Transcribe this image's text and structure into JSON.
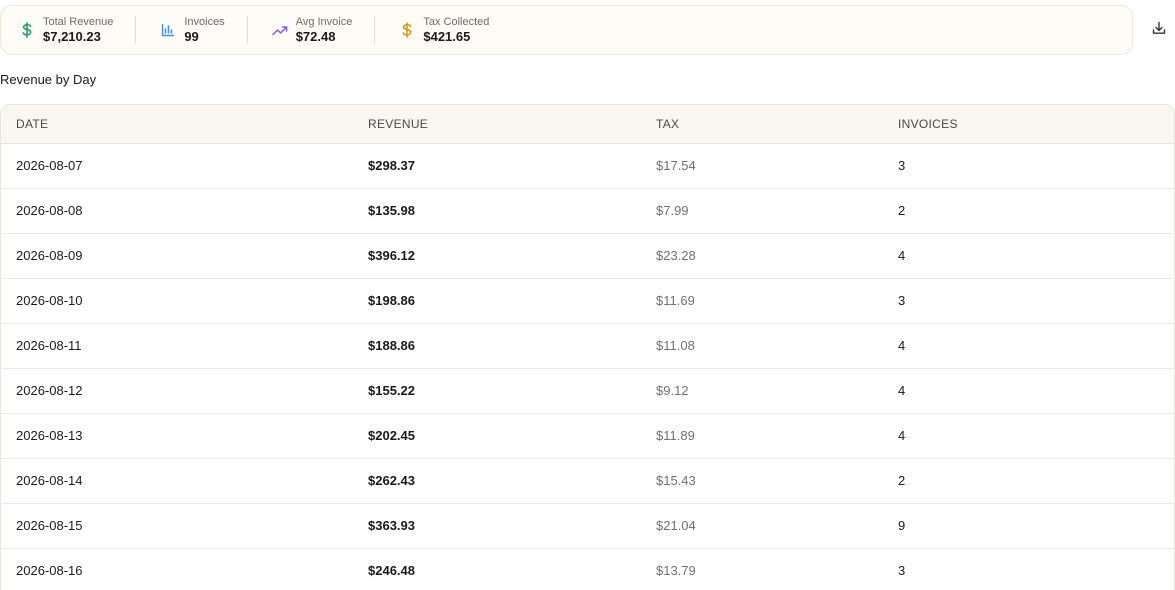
{
  "stats": [
    {
      "label": "Total Revenue",
      "value": "$7,210.23",
      "icon": "dollar-icon",
      "color": "#22a06b"
    },
    {
      "label": "Invoices",
      "value": "99",
      "icon": "bar-chart-icon",
      "color": "#4a8fe0"
    },
    {
      "label": "Avg Invoice",
      "value": "$72.48",
      "icon": "trending-up-icon",
      "color": "#8b5cf6"
    },
    {
      "label": "Tax Collected",
      "value": "$421.65",
      "icon": "dollar-icon",
      "color": "#d99a1a"
    }
  ],
  "download": {
    "icon": "download-icon"
  },
  "section_title": "Revenue by Day",
  "table": {
    "headers": [
      "DATE",
      "REVENUE",
      "TAX",
      "INVOICES"
    ],
    "rows": [
      [
        "2026-08-07",
        "$298.37",
        "$17.54",
        "3"
      ],
      [
        "2026-08-08",
        "$135.98",
        "$7.99",
        "2"
      ],
      [
        "2026-08-09",
        "$396.12",
        "$23.28",
        "4"
      ],
      [
        "2026-08-10",
        "$198.86",
        "$11.69",
        "3"
      ],
      [
        "2026-08-11",
        "$188.86",
        "$11.08",
        "4"
      ],
      [
        "2026-08-12",
        "$155.22",
        "$9.12",
        "4"
      ],
      [
        "2026-08-13",
        "$202.45",
        "$11.89",
        "4"
      ],
      [
        "2026-08-14",
        "$262.43",
        "$15.43",
        "2"
      ],
      [
        "2026-08-15",
        "$363.93",
        "$21.04",
        "9"
      ],
      [
        "2026-08-16",
        "$246.48",
        "$13.79",
        "3"
      ]
    ]
  }
}
